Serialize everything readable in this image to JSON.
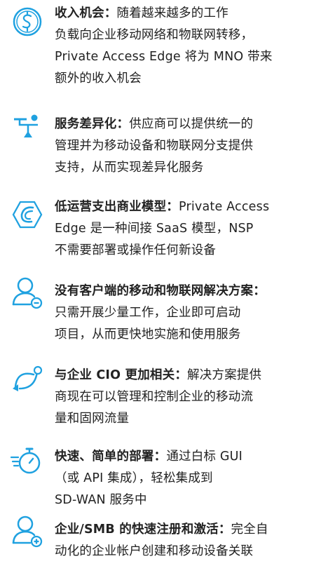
{
  "colors": {
    "accent": "#1fa1e0",
    "text": "#222222"
  },
  "items": [
    {
      "icon": "dollar-coin-icon",
      "title": "收入机会：",
      "lines": [
        "随着越来越多的工作",
        "负载向企业移动网络和物联网转移，",
        "Private Access Edge 将为 MNO 带来",
        "额外的收入机会"
      ]
    },
    {
      "icon": "network-branch-icon",
      "title": "服务差异化：",
      "lines": [
        "供应商可以提供统一的",
        "管理并为移动设备和物联网分支提供",
        "支持，从而实现差异化服务"
      ]
    },
    {
      "icon": "hexagon-logo-icon",
      "title": "低运营支出商业模型：",
      "lines": [
        "Private Access",
        "Edge 是一种间接 SaaS 模型，NSP",
        "不需要部署或操作任何新设备"
      ]
    },
    {
      "icon": "user-minus-icon",
      "title": "没有客户端的移动和物联网解决方案：",
      "lines": [
        "",
        "只需开展少量工作，企业即可启动",
        "项目，从而更快地实施和使用服务"
      ]
    },
    {
      "icon": "connection-curve-icon",
      "title": "与企业 CIO 更加相关：",
      "lines": [
        "解决方案提供",
        "商现在可以管理和控制企业的移动流",
        "量和固网流量"
      ]
    },
    {
      "icon": "stopwatch-icon",
      "title": "快速、简单的部署：",
      "lines": [
        "通过白标 GUI",
        "（或 API 集成），轻松集成到",
        "SD-WAN 服务中"
      ]
    },
    {
      "icon": "user-plus-icon",
      "title": "企业/SMB 的快速注册和激活：",
      "lines": [
        "完全自",
        "动化的企业帐户创建和移动设备关联"
      ]
    }
  ]
}
